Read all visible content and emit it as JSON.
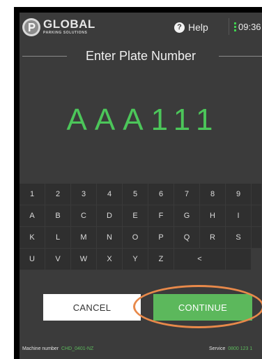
{
  "header": {
    "logo_main": "GLOBAL",
    "logo_sub": "PARKING SOLUTIONS",
    "help_label": "Help",
    "time": "09:36"
  },
  "title": "Enter Plate Number",
  "plate_value": "AAA111",
  "keypad": {
    "rows": [
      [
        "1",
        "2",
        "3",
        "4",
        "5",
        "6",
        "7",
        "8",
        "9",
        ""
      ],
      [
        "A",
        "B",
        "C",
        "D",
        "E",
        "F",
        "G",
        "H",
        "I",
        ""
      ],
      [
        "K",
        "L",
        "M",
        "N",
        "O",
        "P",
        "Q",
        "R",
        "S",
        ""
      ],
      [
        "U",
        "V",
        "W",
        "X",
        "Y",
        "Z",
        "<",
        ""
      ]
    ]
  },
  "buttons": {
    "cancel": "CANCEL",
    "continue": "CONTINUE"
  },
  "footer": {
    "machine_label": "Machine number",
    "machine_value": "CHD_0401-NZ",
    "service_label": "Service",
    "service_value": "0800 123 1"
  },
  "colors": {
    "accent_green": "#5cb85c",
    "plate_green": "#4cc65a",
    "highlight_orange": "#e8894a",
    "background": "#3b3b3b"
  }
}
